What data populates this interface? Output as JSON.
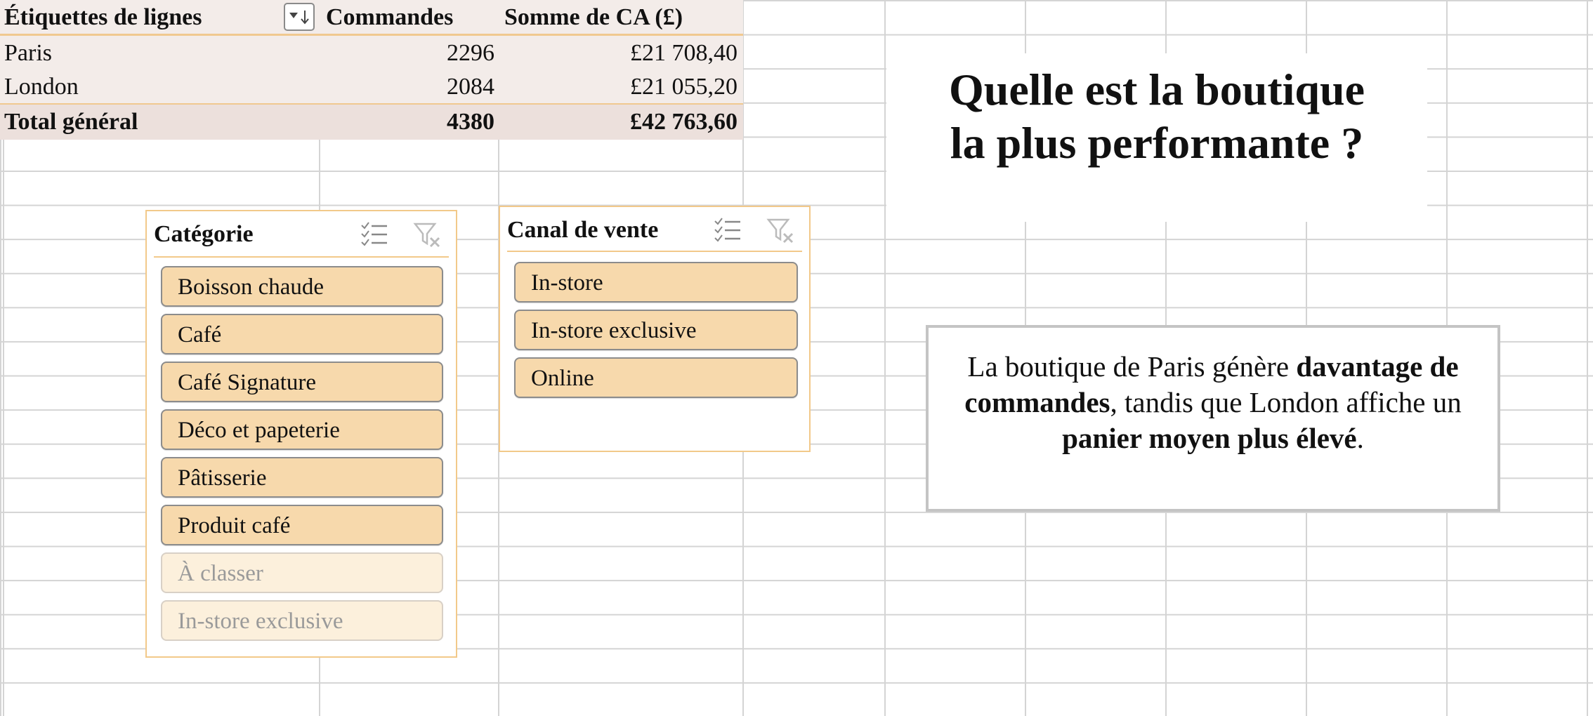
{
  "pivot": {
    "headers": {
      "row_labels": "Étiquettes de lignes",
      "orders": "Commandes",
      "revenue": "Somme de CA (£)"
    },
    "rows": [
      {
        "label": "Paris",
        "orders": "2296",
        "revenue": "£21 708,40"
      },
      {
        "label": "London",
        "orders": "2084",
        "revenue": "£21 055,20"
      }
    ],
    "total": {
      "label": "Total général",
      "orders": "4380",
      "revenue": "£42 763,60"
    }
  },
  "slicer_category": {
    "title": "Catégorie",
    "items": [
      {
        "label": "Boisson chaude",
        "selected": true
      },
      {
        "label": "Café",
        "selected": true
      },
      {
        "label": "Café Signature",
        "selected": true
      },
      {
        "label": "Déco et papeterie",
        "selected": true
      },
      {
        "label": "Pâtisserie",
        "selected": true
      },
      {
        "label": "Produit café",
        "selected": true
      },
      {
        "label": "À classer",
        "selected": false
      },
      {
        "label": "In-store exclusive",
        "selected": false
      }
    ]
  },
  "slicer_channel": {
    "title": "Canal de vente",
    "items": [
      {
        "label": "In-store",
        "selected": true
      },
      {
        "label": "In-store exclusive",
        "selected": true
      },
      {
        "label": "Online",
        "selected": true
      }
    ]
  },
  "title_box": {
    "line1": "Quelle est la boutique",
    "line2": "la plus performante ?"
  },
  "note_box": {
    "part1": "La boutique de Paris génère ",
    "bold1": "davantage de commandes",
    "part2": ", tandis que London affiche un ",
    "bold2": "panier moyen plus élevé",
    "part3": "."
  },
  "colors": {
    "slicer_selected": "#f7d9ac",
    "slicer_unselected": "#fcf0dc",
    "slicer_border": "#f2c98a",
    "pivot_row_bg": "#f3ece9",
    "pivot_total_bg": "#ece0dc"
  }
}
